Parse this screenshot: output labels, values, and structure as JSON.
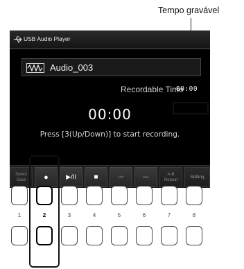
{
  "annotation": {
    "label": "Tempo gravável"
  },
  "screen": {
    "title": "USB Audio Player",
    "file_name": "Audio_003",
    "recordable_time_label": "Recordable Time",
    "recordable_time_value": "80:00",
    "elapsed_time": "00:00",
    "instruction": "Press [3(Up/Down)] to start recording."
  },
  "buttons": {
    "select_save": {
      "line1": "Select",
      "line2": "Save"
    },
    "record": "●",
    "play_pause": "▶/II",
    "stop": "■",
    "prev": "⏮",
    "next": "⏭",
    "ab_repeat": {
      "line1": "A-B",
      "line2": "Repeat"
    },
    "setting": "Setting"
  },
  "hardware": {
    "numbers": [
      "1",
      "2",
      "3",
      "4",
      "5",
      "6",
      "7",
      "8"
    ],
    "selected": "2"
  }
}
